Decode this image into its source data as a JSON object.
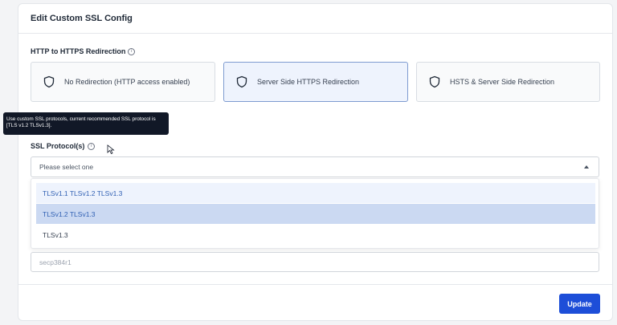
{
  "card": {
    "title": "Edit Custom SSL Config"
  },
  "redirection": {
    "label": "HTTP to HTTPS Redirection",
    "info_icon": "info-icon",
    "options": [
      {
        "label": "No Redirection (HTTP access enabled)",
        "icon": "shield-icon"
      },
      {
        "label": "Server Side HTTPS Redirection",
        "icon": "shield-icon",
        "selected": true
      },
      {
        "label": "HSTS & Server Side Redirection",
        "icon": "shield-icon"
      }
    ]
  },
  "tooltip": {
    "text": "Use custom SSL protocols, current recommended SSL protocol is [TLS v1.2 TLSv1.3]."
  },
  "ssl_protocols": {
    "label": "SSL Protocol(s)",
    "placeholder": "Please select one",
    "options": [
      "TLSv1.1 TLSv1.2 TLSv1.3",
      "TLSv1.2 TLSv1.3",
      "TLSv1.3"
    ]
  },
  "curve": {
    "value": "secp384r1"
  },
  "footer": {
    "update_label": "Update"
  },
  "colors": {
    "accent": "#1d4ed8",
    "selected_bg": "#eef3fd",
    "tooltip_bg": "#111827"
  }
}
